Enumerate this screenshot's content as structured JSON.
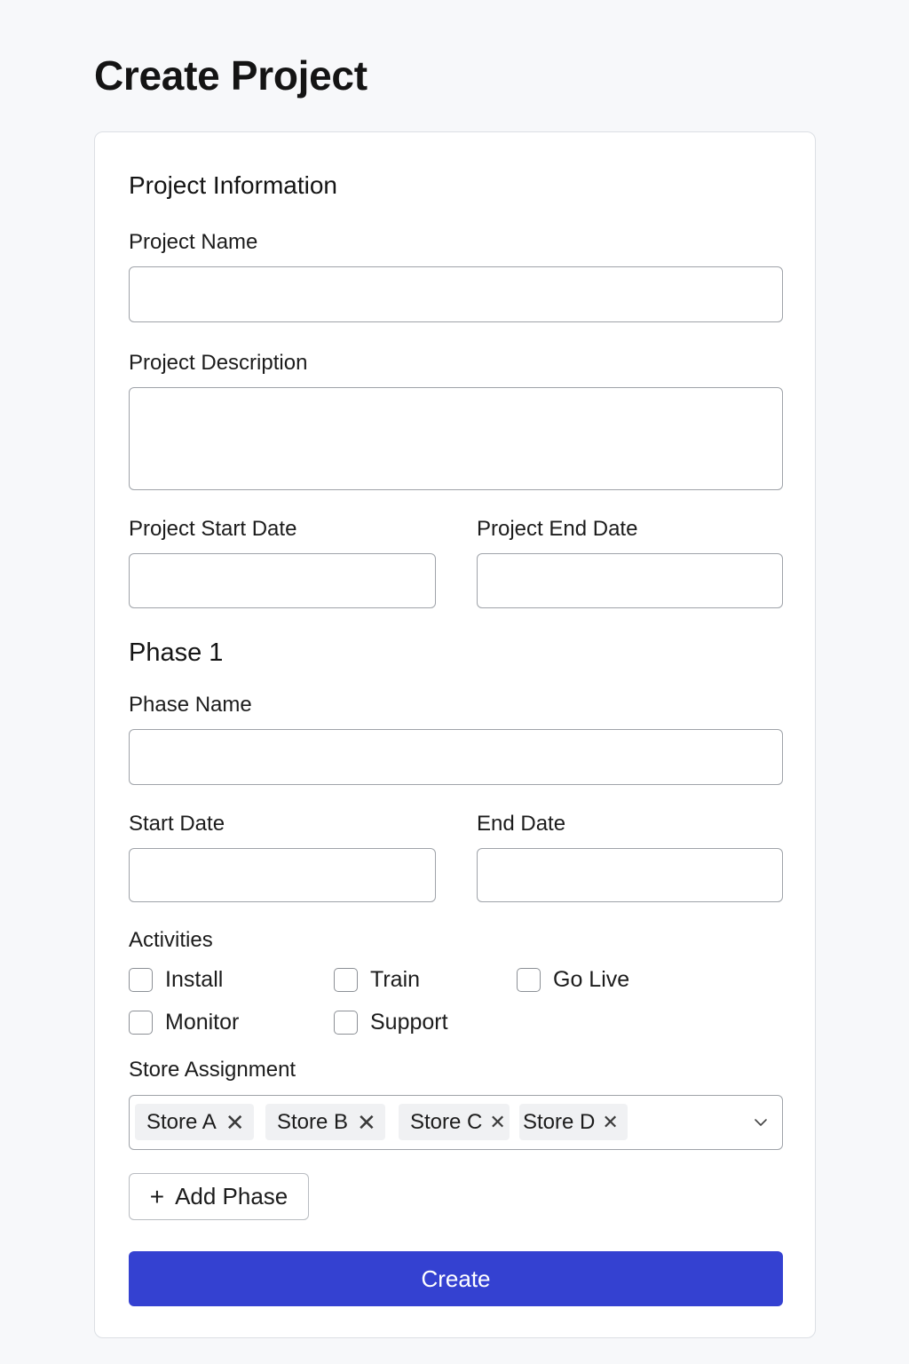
{
  "page": {
    "title": "Create Project"
  },
  "project_info": {
    "heading": "Project Information",
    "name_label": "Project Name",
    "name_value": "",
    "description_label": "Project Description",
    "description_value": "",
    "start_date_label": "Project Start Date",
    "start_date_value": "",
    "end_date_label": "Project End Date",
    "end_date_value": ""
  },
  "phase": {
    "heading": "Phase 1",
    "name_label": "Phase Name",
    "name_value": "",
    "start_date_label": "Start Date",
    "start_date_value": "",
    "end_date_label": "End Date",
    "end_date_value": "",
    "activities_label": "Activities",
    "activities": [
      {
        "label": "Install",
        "checked": false
      },
      {
        "label": "Train",
        "checked": false
      },
      {
        "label": "Go Live",
        "checked": false
      },
      {
        "label": "Monitor",
        "checked": false
      },
      {
        "label": "Support",
        "checked": false
      }
    ],
    "store_assignment_label": "Store Assignment",
    "stores": [
      {
        "label": "Store A",
        "remove_icon": "close-icon"
      },
      {
        "label": "Store B",
        "remove_icon": "close-icon"
      },
      {
        "label": "Store C",
        "remove_icon": "close-icon"
      },
      {
        "label": "Store D",
        "remove_icon": "close-icon"
      }
    ],
    "dropdown_icon": "chevron-down-icon"
  },
  "actions": {
    "add_phase_icon": "plus-icon",
    "add_phase_label": "Add Phase",
    "create_label": "Create"
  },
  "colors": {
    "primary": "#3441d1",
    "background": "#f7f8fa",
    "card": "#ffffff",
    "border": "#9fa3a9"
  }
}
